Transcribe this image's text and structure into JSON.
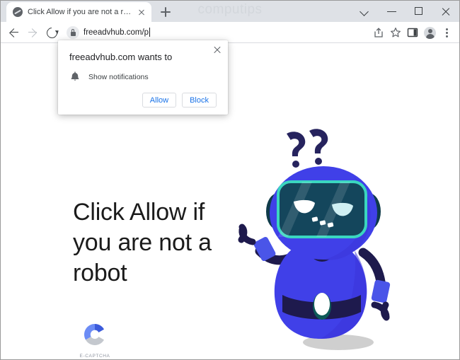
{
  "window": {
    "watermark": "computips",
    "controls": {
      "tab_search": "tab-search",
      "minimize": "minimize",
      "maximize": "maximize",
      "close": "close"
    }
  },
  "tabstrip": {
    "tabs": [
      {
        "title": "Click Allow if you are not a robot",
        "favicon": "globe-icon",
        "close": "close-icon"
      }
    ],
    "new_tab_label": "+"
  },
  "toolbar": {
    "back": "back-arrow-icon",
    "forward": "forward-arrow-icon",
    "reload": "reload-icon",
    "security_icon": "lock-icon",
    "url": "freeadvhub.com/p",
    "share": "share-icon",
    "bookmark": "star-icon",
    "side_panel": "side-panel-icon",
    "profile": "profile-avatar-icon",
    "menu": "three-dot-menu-icon"
  },
  "permission_dialog": {
    "title": "freeadvhub.com wants to",
    "option_icon": "bell-icon",
    "option_label": "Show notifications",
    "allow_label": "Allow",
    "block_label": "Block",
    "close_label": "close-icon"
  },
  "page": {
    "headline": "Click Allow if you are not a robot",
    "captcha": {
      "logo": "c-logo-icon",
      "label": "E-CAPTCHA"
    },
    "illustration": {
      "name": "confused-robot-illustration",
      "question_marks": "??",
      "colors": {
        "body": "#4040e8",
        "body_dark": "#1e1a4d",
        "screen": "#14465c",
        "screen_border": "#3ad6c0",
        "shadow": "#cfcfcf"
      }
    }
  },
  "colors": {
    "titlebar": "#dee1e6",
    "accent": "#1a73e8",
    "text": "#202124"
  }
}
